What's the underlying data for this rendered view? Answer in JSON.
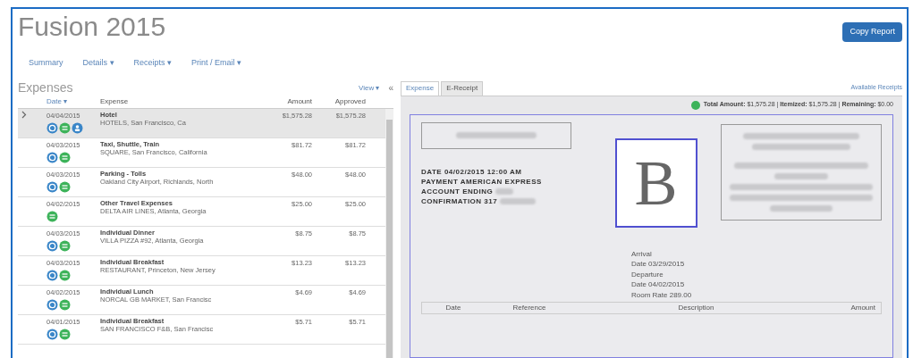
{
  "title": "Fusion 2015",
  "action_button": "Copy Report",
  "nav": [
    "Summary",
    "Details ▾",
    "Receipts ▾",
    "Print / Email ▾"
  ],
  "expenses": {
    "heading": "Expenses",
    "view": "View ▾",
    "collapse": "«",
    "columns": [
      "Date ▾",
      "Expense",
      "Amount",
      "Approved"
    ],
    "rows": [
      {
        "date": "04/04/2015",
        "type": "Hotel",
        "vendor": "HOTELS, San Francisco, Ca",
        "amount": "$1,575.28",
        "approved": "$1,575.28",
        "selected": true,
        "icons": [
          {
            "kind": "receipt"
          },
          {
            "kind": "itemized"
          },
          {
            "kind": "attendee"
          }
        ]
      },
      {
        "date": "04/03/2015",
        "type": "Taxi, Shuttle, Train",
        "vendor": "SQUARE, San Francisco, California",
        "amount": "$81.72",
        "approved": "$81.72",
        "selected": false,
        "icons": [
          {
            "kind": "receipt"
          },
          {
            "kind": "itemized"
          }
        ]
      },
      {
        "date": "04/03/2015",
        "type": "Parking - Tolls",
        "vendor": "Oakland City Airport, Richlands, North",
        "amount": "$48.00",
        "approved": "$48.00",
        "selected": false,
        "icons": [
          {
            "kind": "receipt"
          },
          {
            "kind": "itemized"
          }
        ]
      },
      {
        "date": "04/02/2015",
        "type": "Other Travel Expenses",
        "vendor": "DELTA AIR LINES, Atlanta, Georgia",
        "amount": "$25.00",
        "approved": "$25.00",
        "selected": false,
        "icons": [
          {
            "kind": "itemized"
          }
        ]
      },
      {
        "date": "04/03/2015",
        "type": "Individual Dinner",
        "vendor": "VILLA PIZZA #92, Atlanta, Georgia",
        "amount": "$8.75",
        "approved": "$8.75",
        "selected": false,
        "icons": [
          {
            "kind": "receipt"
          },
          {
            "kind": "itemized"
          }
        ]
      },
      {
        "date": "04/03/2015",
        "type": "Individual Breakfast",
        "vendor": "RESTAURANT, Princeton, New Jersey",
        "amount": "$13.23",
        "approved": "$13.23",
        "selected": false,
        "icons": [
          {
            "kind": "receipt"
          },
          {
            "kind": "itemized"
          }
        ]
      },
      {
        "date": "04/02/2015",
        "type": "Individual Lunch",
        "vendor": "NORCAL GB MARKET, San Francisc",
        "amount": "$4.69",
        "approved": "$4.69",
        "selected": false,
        "icons": [
          {
            "kind": "receipt"
          },
          {
            "kind": "itemized"
          }
        ]
      },
      {
        "date": "04/01/2015",
        "type": "Individual Breakfast",
        "vendor": "SAN FRANCISCO F&B, San Francisc",
        "amount": "$5.71",
        "approved": "$5.71",
        "selected": false,
        "icons": [
          {
            "kind": "receipt"
          },
          {
            "kind": "itemized"
          }
        ]
      }
    ]
  },
  "detail": {
    "tabs": [
      {
        "label": "Expense",
        "selected": false
      },
      {
        "label": "E-Receipt",
        "selected": true
      }
    ],
    "available_link": "Available Receipts",
    "totals": "**Total Amount:** $1,575.28 | **Itemized:** $1,575.28 | **Remaining:** $0.00",
    "receipt": {
      "payment_lines": [
        "DATE 04/02/2015 12:00 AM",
        "PAYMENT AMERICAN EXPRESS",
        "ACCOUNT ENDING",
        "CONFIRMATION 317"
      ],
      "logo_letter": "B",
      "stay_lines": [
        "Arrival",
        "Date 03/29/2015",
        "Departure",
        "Date 04/02/2015",
        "Room Rate 289.00"
      ],
      "columns": [
        "Date",
        "Reference",
        "Description",
        "Amount"
      ]
    }
  }
}
